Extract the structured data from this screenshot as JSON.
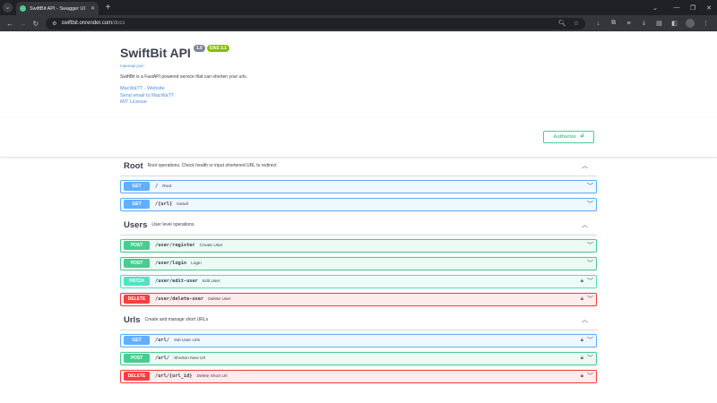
{
  "browser": {
    "tab_title": "SwiftBit API - Swagger UI",
    "url_host": "swiftbit.onrender.com",
    "url_path": "/docs"
  },
  "colors": {
    "get": "#61affe",
    "post": "#49cc90",
    "patch": "#50e3c2",
    "delete": "#f93e3e",
    "oas_badge": "#89bf04",
    "version_badge": "#7d8492"
  },
  "info": {
    "title": "SwiftBit API",
    "version": "1.0",
    "oas": "OAS 3.1",
    "openapi_link": "/openapi.json",
    "description": "SwiftBit is a FastAPI powered service that can shorten your urls.",
    "links": [
      "MacWaTT - Website",
      "Send email to MacWaTT",
      "MIT License"
    ]
  },
  "authorize": {
    "label": "Authorize"
  },
  "tags": [
    {
      "name": "Root",
      "description": "Root operations. Check health or input shortened URL to redirect",
      "operations": [
        {
          "method": "GET",
          "path": "/",
          "summary": "Root",
          "locked": false
        },
        {
          "method": "GET",
          "path": "/{url}",
          "summary": "Geturl",
          "locked": false
        }
      ]
    },
    {
      "name": "Users",
      "description": "User level operations.",
      "operations": [
        {
          "method": "POST",
          "path": "/user/register",
          "summary": "Create User",
          "locked": false
        },
        {
          "method": "POST",
          "path": "/user/login",
          "summary": "Login",
          "locked": false
        },
        {
          "method": "PATCH",
          "path": "/user/edit-user",
          "summary": "Edit User",
          "locked": true
        },
        {
          "method": "DELETE",
          "path": "/user/delete-user",
          "summary": "Delete User",
          "locked": true
        }
      ]
    },
    {
      "name": "Urls",
      "description": "Create and manage short URLs",
      "operations": [
        {
          "method": "GET",
          "path": "/url/",
          "summary": "Get User Urls",
          "locked": true
        },
        {
          "method": "POST",
          "path": "/url/",
          "summary": "Shorten New Url",
          "locked": true
        },
        {
          "method": "DELETE",
          "path": "/url/{url_id}",
          "summary": "Delete Short Url",
          "locked": true
        }
      ]
    }
  ]
}
